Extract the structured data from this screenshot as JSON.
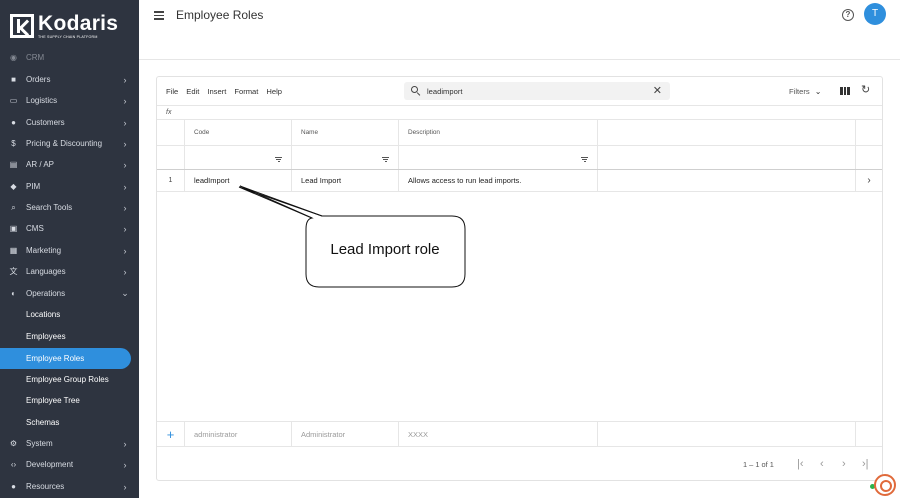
{
  "app": {
    "brand": "Kodaris",
    "tagline": "THE SUPPLY CHAIN PLATFORM"
  },
  "header": {
    "title": "Employee Roles",
    "help_icon": "help-circle-icon",
    "avatar_initial": "T"
  },
  "sidebar": {
    "items": [
      {
        "label": "CRM",
        "icon": "crm-icon",
        "chev": "›"
      },
      {
        "label": "Orders",
        "icon": "truck-icon",
        "chev": "›"
      },
      {
        "label": "Logistics",
        "icon": "shipping-icon",
        "chev": "›"
      },
      {
        "label": "Customers",
        "icon": "people-icon",
        "chev": "›"
      },
      {
        "label": "Pricing & Discounting",
        "icon": "dollar-icon",
        "chev": "›"
      },
      {
        "label": "AR / AP",
        "icon": "bank-icon",
        "chev": "›"
      },
      {
        "label": "PIM",
        "icon": "tag-icon",
        "chev": "›"
      },
      {
        "label": "Search Tools",
        "icon": "search-icon",
        "chev": "›"
      },
      {
        "label": "CMS",
        "icon": "cms-icon",
        "chev": "›"
      },
      {
        "label": "Marketing",
        "icon": "marketing-icon",
        "chev": "›"
      },
      {
        "label": "Languages",
        "icon": "translate-icon",
        "chev": "›"
      },
      {
        "label": "Operations",
        "icon": "operations-icon",
        "chev": "⌄"
      }
    ],
    "operations_sub": [
      {
        "label": "Locations"
      },
      {
        "label": "Employees"
      },
      {
        "label": "Employee Roles",
        "active": true
      },
      {
        "label": "Employee Group Roles"
      },
      {
        "label": "Employee Tree"
      },
      {
        "label": "Schemas"
      }
    ],
    "bottom_items": [
      {
        "label": "System",
        "icon": "gear-icon",
        "chev": "›"
      },
      {
        "label": "Development",
        "icon": "code-icon",
        "chev": "›"
      },
      {
        "label": "Resources",
        "icon": "help-icon",
        "chev": "›"
      }
    ]
  },
  "toolbar": {
    "menu": [
      "File",
      "Edit",
      "Insert",
      "Format",
      "Help"
    ],
    "search_value": "leadimport",
    "filters_label": "Filters"
  },
  "formula_bar": {
    "label": "fx"
  },
  "grid": {
    "columns": [
      "Code",
      "Name",
      "Description"
    ],
    "rows": [
      {
        "num": "1",
        "code": "leadImport",
        "name": "Lead Import",
        "description": "Allows access to run lead imports."
      }
    ],
    "new_row": {
      "code": "administrator",
      "name": "Administrator",
      "description": "XXXX"
    }
  },
  "pager": {
    "count": "1 – 1 of 1"
  },
  "callout": {
    "text": "Lead Import role"
  },
  "colors": {
    "sidebar_bg": "#2e3440",
    "accent": "#2f8fdd"
  }
}
